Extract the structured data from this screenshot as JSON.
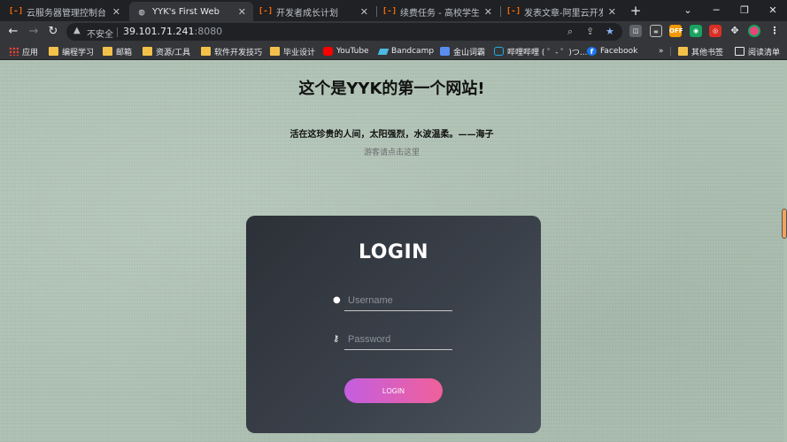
{
  "browser": {
    "tabs": [
      {
        "title": "云服务器管理控制台",
        "active": false
      },
      {
        "title": "YYK's First Web",
        "active": true
      },
      {
        "title": "开发者成长计划",
        "active": false
      },
      {
        "title": "续费任务 - 高校学生免费",
        "active": false
      },
      {
        "title": "发表文章-阿里云开发者社",
        "active": false
      }
    ],
    "omnibox": {
      "security_label": "不安全",
      "host": "39.101.71.241",
      "port": ":8080"
    },
    "extensions": {
      "off_badge": "OFF"
    },
    "bookmarks": [
      {
        "label": "应用",
        "icon": "apps-grid-icon"
      },
      {
        "label": "编程学习",
        "icon": "folder-icon"
      },
      {
        "label": "邮箱",
        "icon": "folder-icon"
      },
      {
        "label": "资源/工具",
        "icon": "folder-icon"
      },
      {
        "label": "软件开发技巧",
        "icon": "folder-icon"
      },
      {
        "label": "毕业设计",
        "icon": "folder-icon"
      },
      {
        "label": "YouTube",
        "icon": "youtube-icon"
      },
      {
        "label": "Bandcamp",
        "icon": "bandcamp-icon"
      },
      {
        "label": "金山词霸",
        "icon": "jinshan-icon"
      },
      {
        "label": "哔哩哔哩 ( ゜- ゜)つ...",
        "icon": "bilibili-icon"
      },
      {
        "label": "Facebook",
        "icon": "facebook-icon"
      }
    ],
    "overflow_label": "»",
    "other_bookmarks": "其他书签",
    "reading_list": "阅读清单"
  },
  "page": {
    "headline": "这个是YYK的第一个网站!",
    "poem": "活在这珍贵的人间，太阳强烈，水波温柔。——海子",
    "guest_link": "游客请点击这里",
    "login": {
      "title": "LOGIN",
      "username_placeholder": "Username",
      "password_placeholder": "Password",
      "button_label": "LOGIN"
    }
  },
  "colors": {
    "page_bg": "#adc0b2",
    "card_bg": "#3a4049",
    "button_gradient_start": "#c45ee0",
    "button_gradient_end": "#f0609a"
  }
}
